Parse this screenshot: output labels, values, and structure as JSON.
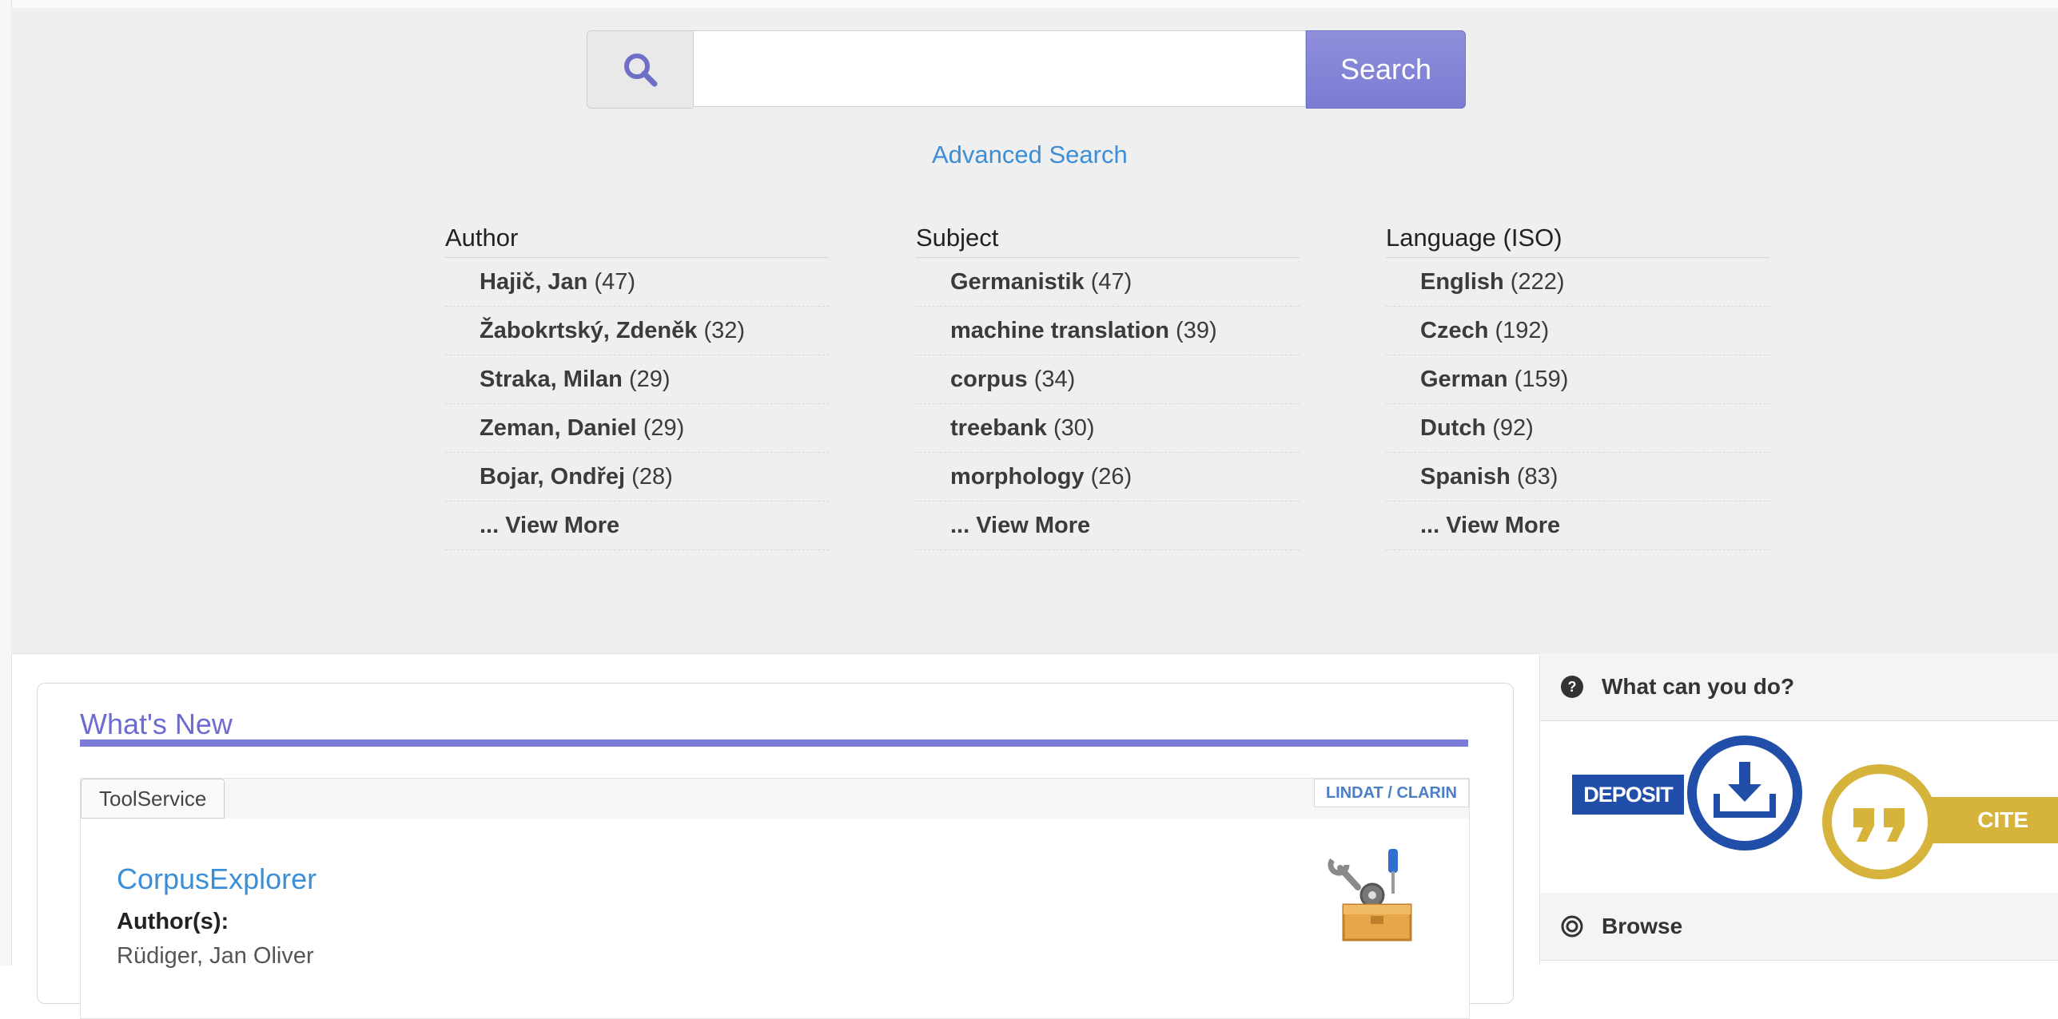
{
  "search": {
    "placeholder": "",
    "button_label": "Search",
    "advanced_label": "Advanced Search"
  },
  "facets": [
    {
      "title": "Author",
      "items": [
        {
          "name": "Hajič, Jan",
          "count": "(47)"
        },
        {
          "name": "Žabokrtský, Zdeněk",
          "count": "(32)"
        },
        {
          "name": "Straka, Milan",
          "count": "(29)"
        },
        {
          "name": "Zeman, Daniel",
          "count": "(29)"
        },
        {
          "name": "Bojar, Ondřej",
          "count": "(28)"
        }
      ],
      "more": "... View More"
    },
    {
      "title": "Subject",
      "items": [
        {
          "name": "Germanistik",
          "count": "(47)"
        },
        {
          "name": "machine translation",
          "count": "(39)"
        },
        {
          "name": "corpus",
          "count": "(34)"
        },
        {
          "name": "treebank",
          "count": "(30)"
        },
        {
          "name": "morphology",
          "count": "(26)"
        }
      ],
      "more": "... View More"
    },
    {
      "title": "Language (ISO)",
      "items": [
        {
          "name": "English",
          "count": "(222)"
        },
        {
          "name": "Czech",
          "count": "(192)"
        },
        {
          "name": "German",
          "count": "(159)"
        },
        {
          "name": "Dutch",
          "count": "(92)"
        },
        {
          "name": "Spanish",
          "count": "(83)"
        }
      ],
      "more": "... View More"
    }
  ],
  "whats_new": {
    "title": "What's New",
    "item": {
      "type_tag": "ToolService",
      "collection_tag": "LINDAT / CLARIN",
      "title": "CorpusExplorer",
      "author_label": "Author(s):",
      "author": "Rüdiger, Jan Oliver",
      "icon": "toolbox-icon"
    }
  },
  "sidebar": {
    "what_can_you_do": "What can you do?",
    "deposit_label": "DEPOSIT",
    "cite_label": "CITE",
    "browse_label": "Browse"
  },
  "colors": {
    "accent": "#7b7bd8",
    "link": "#3c8ed6",
    "deposit_blue": "#214ea8",
    "cite_gold": "#d6b33a"
  }
}
